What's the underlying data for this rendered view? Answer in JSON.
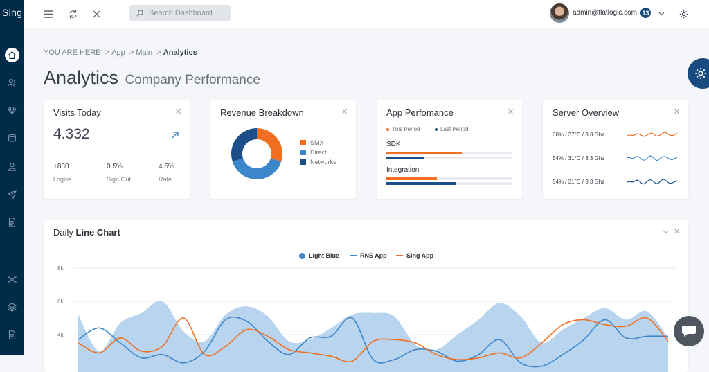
{
  "app": {
    "logo": "Sing"
  },
  "topbar": {
    "search_placeholder": "Search Dashboard",
    "user_email": "admin@flatlogic.com",
    "notification_count": "13"
  },
  "breadcrumb": {
    "prefix": "YOU ARE HERE",
    "items": [
      "App",
      "Main"
    ],
    "current": "Analytics"
  },
  "page": {
    "title": "Analytics",
    "subtitle": "Company Performance"
  },
  "visits": {
    "title": "Visits Today",
    "value": "4.332",
    "stats": [
      {
        "value": "+830",
        "label": "Logins"
      },
      {
        "value": "0.5%",
        "label": "Sign Out"
      },
      {
        "value": "4.5%",
        "label": "Rate"
      }
    ]
  },
  "revenue": {
    "title": "Revenue Breakdown",
    "legend": [
      "SMX",
      "Direct",
      "Networks"
    ],
    "colors": [
      "#f26f21",
      "#3d86cc",
      "#1c4f88"
    ],
    "slices": [
      30,
      40,
      30
    ]
  },
  "app_perf": {
    "title": "App Perfomance",
    "legend": [
      "This Period",
      "Last Period"
    ],
    "items": [
      {
        "label": "SDK",
        "this": 0.6,
        "last": 0.3
      },
      {
        "label": "Integration",
        "this": 0.4,
        "last": 0.55
      }
    ]
  },
  "server": {
    "title": "Server Overview",
    "rows": [
      {
        "text": "60% / 37°C / 3.3 Ghz",
        "color": "#f26f21"
      },
      {
        "text": "54% / 31°C / 3.3 Ghz",
        "color": "#3d86cc"
      },
      {
        "text": "54% / 31°C / 3.3 Ghz",
        "color": "#1c4f88"
      }
    ]
  },
  "line_chart": {
    "title_pre": "Daily",
    "title_bold": "Line Chart"
  },
  "chart_data": {
    "type": "area",
    "title": "Daily Line Chart",
    "legend": [
      "Light Blue",
      "RNS App",
      "Sing App"
    ],
    "colors": {
      "Light Blue": "#b8d4ee",
      "RNS App": "#3d86cc",
      "Sing App": "#f26f21"
    },
    "yticks": [
      "8k",
      "6k",
      "4k"
    ],
    "ylim": [
      0,
      8000
    ],
    "series": [
      {
        "name": "Light Blue",
        "values": [
          5200,
          3000,
          4700,
          5300,
          6000,
          4200,
          3600,
          5200,
          5700,
          5100,
          3600,
          3700,
          4400,
          5200,
          5300,
          5100,
          3400,
          3100,
          4000,
          4900,
          5900,
          5100,
          3500,
          4300,
          5000,
          5600,
          4900,
          5400,
          3800
        ]
      },
      {
        "name": "RNS App",
        "values": [
          3700,
          4400,
          3500,
          2600,
          2800,
          2300,
          3000,
          4900,
          4800,
          3600,
          2800,
          3800,
          3900,
          5000,
          2500,
          2500,
          3100,
          3000,
          2400,
          2800,
          3700,
          2300,
          2100,
          2800,
          3700,
          4900,
          3800,
          3900,
          3900
        ]
      },
      {
        "name": "Sing App",
        "values": [
          3500,
          2900,
          3800,
          3000,
          3300,
          5000,
          2800,
          3300,
          4300,
          3900,
          3100,
          2900,
          2700,
          2400,
          3600,
          3700,
          3500,
          2800,
          2500,
          2600,
          2900,
          2600,
          3500,
          4600,
          4900,
          4600,
          4500,
          5000,
          3600
        ]
      }
    ]
  }
}
